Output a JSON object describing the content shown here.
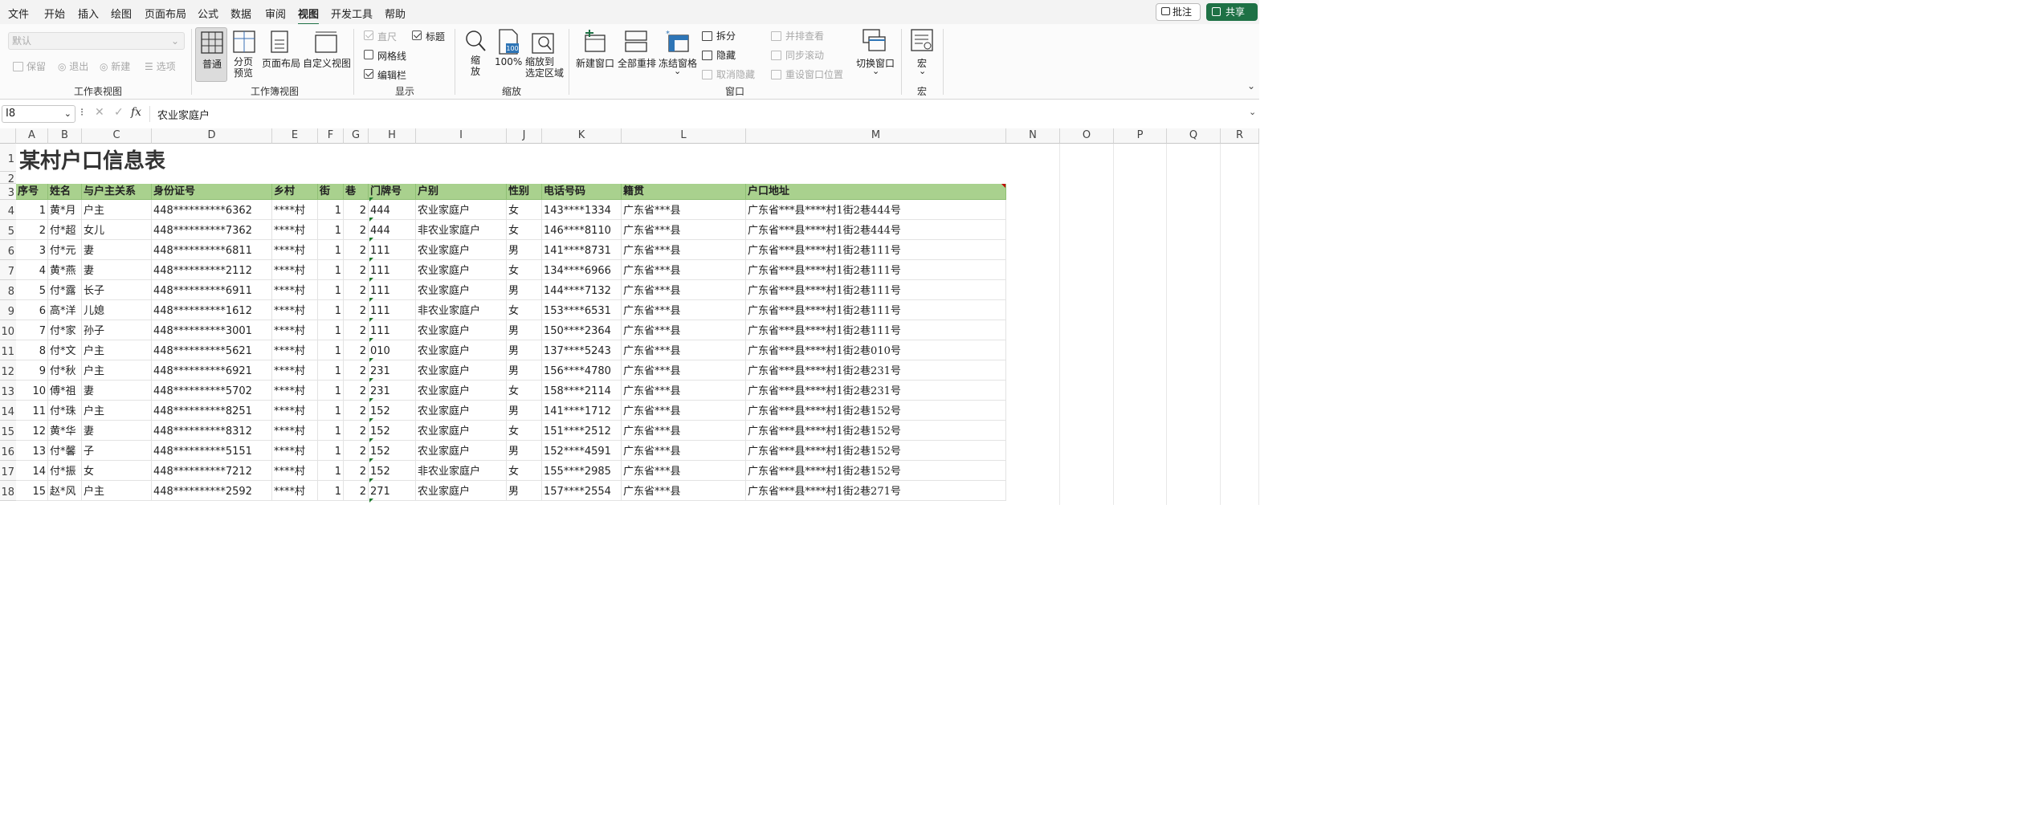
{
  "menu": [
    "文件",
    "开始",
    "插入",
    "绘图",
    "页面布局",
    "公式",
    "数据",
    "审阅",
    "视图",
    "开发工具",
    "帮助"
  ],
  "active_menu": "视图",
  "comment_label": "批注",
  "share_label": "共享",
  "ribbon": {
    "sheetview": {
      "dropdown_value": "默认",
      "keep": "保留",
      "exit": "退出",
      "new": "新建",
      "options": "选项",
      "group": "工作表视图"
    },
    "bookview": {
      "normal": "普通",
      "pagebreak": "分页\n预览",
      "pagelayout": "页面布局",
      "custom": "自定义视图",
      "group": "工作簿视图"
    },
    "show": {
      "ruler": "直尺",
      "gridlines": "网格线",
      "formulabar": "编辑栏",
      "headings": "标题",
      "group": "显示"
    },
    "zoom": {
      "zoom": "缩\n放",
      "hundred": "100%",
      "selection": "缩放到\n选定区域",
      "group": "缩放"
    },
    "window": {
      "newwin": "新建窗口",
      "arrange": "全部重排",
      "freeze": "冻结窗格",
      "split": "拆分",
      "hide": "隐藏",
      "unhide": "取消隐藏",
      "sidebyside": "并排查看",
      "syncscroll": "同步滚动",
      "resetpos": "重设窗口位置",
      "switch": "切换窗口",
      "group": "窗口"
    },
    "macro": {
      "macro": "宏",
      "group": "宏"
    }
  },
  "formula": {
    "namebox": "I8",
    "content": "农业家庭户"
  },
  "columns": [
    "A",
    "B",
    "C",
    "D",
    "E",
    "F",
    "G",
    "H",
    "I",
    "J",
    "K",
    "L",
    "M",
    "N",
    "O",
    "P",
    "Q",
    "R"
  ],
  "rows": [
    "1",
    "2",
    "3",
    "4",
    "5",
    "6",
    "7",
    "8",
    "9",
    "10",
    "11",
    "12",
    "13",
    "14",
    "15",
    "16",
    "17",
    "18"
  ],
  "sheet_title": "某村户口信息表",
  "table_header": [
    "序号",
    "姓名",
    "与户主关系",
    "身份证号",
    "乡村",
    "街",
    "巷",
    "门牌号",
    "户别",
    "性别",
    "电话号码",
    "籍贯",
    "户口地址"
  ],
  "table_rows": [
    [
      "1",
      "黄*月",
      "户主",
      "448**********6362",
      "****村",
      "1",
      "2",
      "444",
      "农业家庭户",
      "女",
      "143****1334",
      "广东省***县",
      "广东省***县****村1街2巷444号"
    ],
    [
      "2",
      "付*超",
      "女儿",
      "448**********7362",
      "****村",
      "1",
      "2",
      "444",
      "非农业家庭户",
      "女",
      "146****8110",
      "广东省***县",
      "广东省***县****村1街2巷444号"
    ],
    [
      "3",
      "付*元",
      "妻",
      "448**********6811",
      "****村",
      "1",
      "2",
      "111",
      "农业家庭户",
      "男",
      "141****8731",
      "广东省***县",
      "广东省***县****村1街2巷111号"
    ],
    [
      "4",
      "黄*燕",
      "妻",
      "448**********2112",
      "****村",
      "1",
      "2",
      "111",
      "农业家庭户",
      "女",
      "134****6966",
      "广东省***县",
      "广东省***县****村1街2巷111号"
    ],
    [
      "5",
      "付*露",
      "长子",
      "448**********6911",
      "****村",
      "1",
      "2",
      "111",
      "农业家庭户",
      "男",
      "144****7132",
      "广东省***县",
      "广东省***县****村1街2巷111号"
    ],
    [
      "6",
      "高*洋",
      "儿媳",
      "448**********1612",
      "****村",
      "1",
      "2",
      "111",
      "非农业家庭户",
      "女",
      "153****6531",
      "广东省***县",
      "广东省***县****村1街2巷111号"
    ],
    [
      "7",
      "付*家",
      "孙子",
      "448**********3001",
      "****村",
      "1",
      "2",
      "111",
      "农业家庭户",
      "男",
      "150****2364",
      "广东省***县",
      "广东省***县****村1街2巷111号"
    ],
    [
      "8",
      "付*文",
      "户主",
      "448**********5621",
      "****村",
      "1",
      "2",
      "010",
      "农业家庭户",
      "男",
      "137****5243",
      "广东省***县",
      "广东省***县****村1街2巷010号"
    ],
    [
      "9",
      "付*秋",
      "户主",
      "448**********6921",
      "****村",
      "1",
      "2",
      "231",
      "农业家庭户",
      "男",
      "156****4780",
      "广东省***县",
      "广东省***县****村1街2巷231号"
    ],
    [
      "10",
      "傅*祖",
      "妻",
      "448**********5702",
      "****村",
      "1",
      "2",
      "231",
      "农业家庭户",
      "女",
      "158****2114",
      "广东省***县",
      "广东省***县****村1街2巷231号"
    ],
    [
      "11",
      "付*珠",
      "户主",
      "448**********8251",
      "****村",
      "1",
      "2",
      "152",
      "农业家庭户",
      "男",
      "141****1712",
      "广东省***县",
      "广东省***县****村1街2巷152号"
    ],
    [
      "12",
      "黄*华",
      "妻",
      "448**********8312",
      "****村",
      "1",
      "2",
      "152",
      "农业家庭户",
      "女",
      "151****2512",
      "广东省***县",
      "广东省***县****村1街2巷152号"
    ],
    [
      "13",
      "付*馨",
      "子",
      "448**********5151",
      "****村",
      "1",
      "2",
      "152",
      "农业家庭户",
      "男",
      "152****4591",
      "广东省***县",
      "广东省***县****村1街2巷152号"
    ],
    [
      "14",
      "付*振",
      "女",
      "448**********7212",
      "****村",
      "1",
      "2",
      "152",
      "非农业家庭户",
      "女",
      "155****2985",
      "广东省***县",
      "广东省***县****村1街2巷152号"
    ],
    [
      "15",
      "赵*风",
      "户主",
      "448**********2592",
      "****村",
      "1",
      "2",
      "271",
      "农业家庭户",
      "男",
      "157****2554",
      "广东省***县",
      "广东省***县****村1街2巷271号"
    ]
  ]
}
